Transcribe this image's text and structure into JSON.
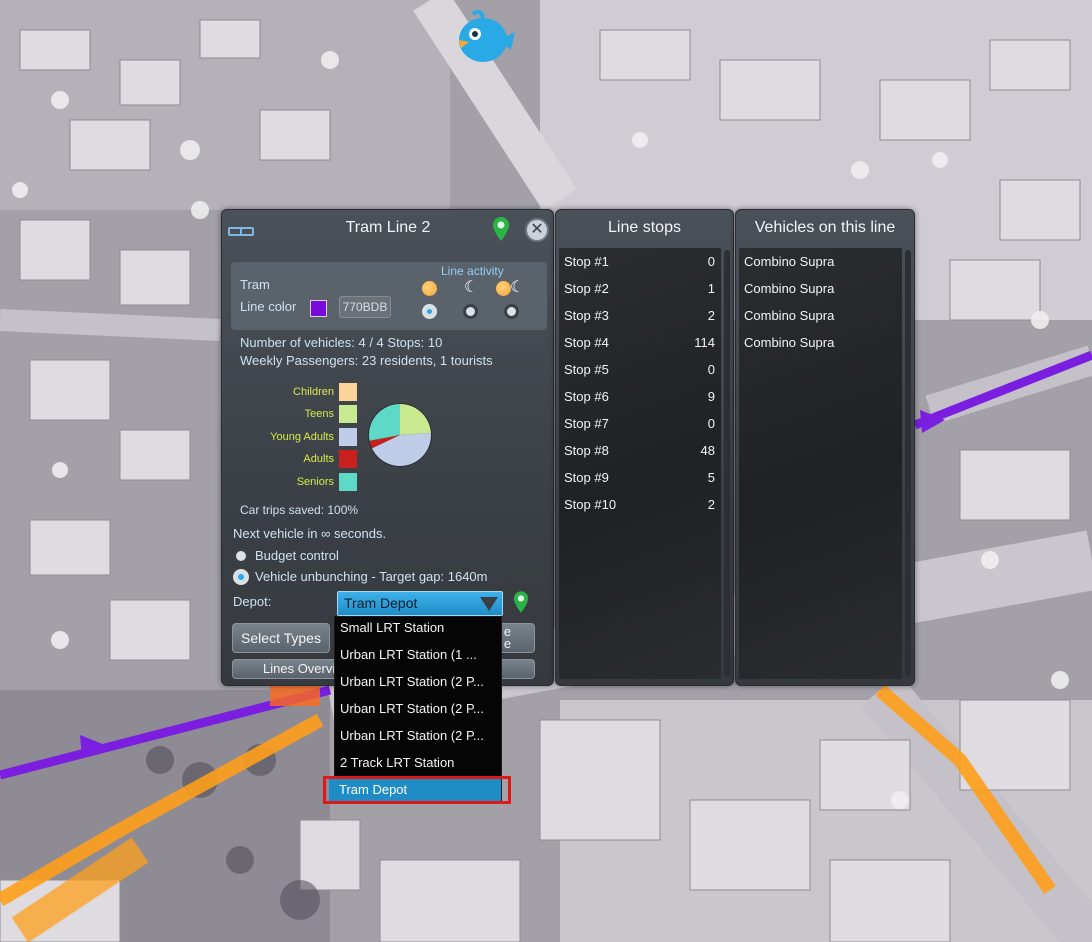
{
  "line_panel": {
    "title": "Tram Line 2",
    "transport_type": "Tram",
    "line_color_label": "Line color",
    "line_color": "#770BDB",
    "line_color_hex": "770BDB",
    "line_activity_label": "Line activity",
    "activity_options": [
      "day",
      "night",
      "day-and-night"
    ],
    "activity_selected": "day",
    "vehicles_stops": "Number of vehicles: 4 / 4   Stops: 10",
    "weekly_passengers": "Weekly Passengers: 23 residents, 1 tourists",
    "age_groups": [
      {
        "label": "Children",
        "color": "#fcd49a",
        "share": 0
      },
      {
        "label": "Teens",
        "color": "#c7e98f",
        "share": 0.24
      },
      {
        "label": "Young Adults",
        "color": "#c0cde8",
        "share": 0.44
      },
      {
        "label": "Adults",
        "color": "#c8201f",
        "share": 0.04
      },
      {
        "label": "Seniors",
        "color": "#5ed8c7",
        "share": 0.28
      }
    ],
    "car_trips_saved": "Car trips saved: 100%",
    "next_vehicle": "Next vehicle in ∞ seconds.",
    "budget_control": "Budget control",
    "budget_control_on": false,
    "unbunching": "Vehicle unbunching - Target gap: 1640m",
    "unbunching_on": true,
    "depot_label": "Depot:",
    "depot_selected": "Tram Depot",
    "select_types_label": "Select Types",
    "hidden_button_fragment_top": "e",
    "hidden_button_fragment_bottom": "e",
    "lines_overview_label": "Lines Overvi"
  },
  "depot_dropdown": {
    "options": [
      "Small LRT Station",
      "Urban LRT Station (1 ...",
      "Urban LRT Station (2 P...",
      "Urban LRT Station (2 P...",
      "Urban LRT Station (2 P...",
      "2 Track LRT Station",
      "Tram Depot"
    ],
    "selected_index": 6
  },
  "stops_panel": {
    "title": "Line stops",
    "stops": [
      {
        "name": "Stop #1",
        "count": "0"
      },
      {
        "name": "Stop #2",
        "count": "1"
      },
      {
        "name": "Stop #3",
        "count": "2"
      },
      {
        "name": "Stop #4",
        "count": "114"
      },
      {
        "name": "Stop #5",
        "count": "0"
      },
      {
        "name": "Stop #6",
        "count": "9"
      },
      {
        "name": "Stop #7",
        "count": "0"
      },
      {
        "name": "Stop #8",
        "count": "48"
      },
      {
        "name": "Stop #9",
        "count": "5"
      },
      {
        "name": "Stop #10",
        "count": "2"
      }
    ]
  },
  "vehicles_panel": {
    "title": "Vehicles on this line",
    "vehicles": [
      "Combino Supra",
      "Combino Supra",
      "Combino Supra",
      "Combino Supra"
    ]
  },
  "colors": {
    "line_purple": "#7a1ee0",
    "road_orange": "#ff9f1a",
    "selection_blue": "#1f8cc6",
    "highlight_red": "#e01818"
  },
  "icons": [
    "chirper-bird-icon",
    "map-pin-icon",
    "close-icon",
    "transport-line-icon",
    "sun-icon",
    "moon-icon",
    "dropdown-arrow-icon"
  ]
}
